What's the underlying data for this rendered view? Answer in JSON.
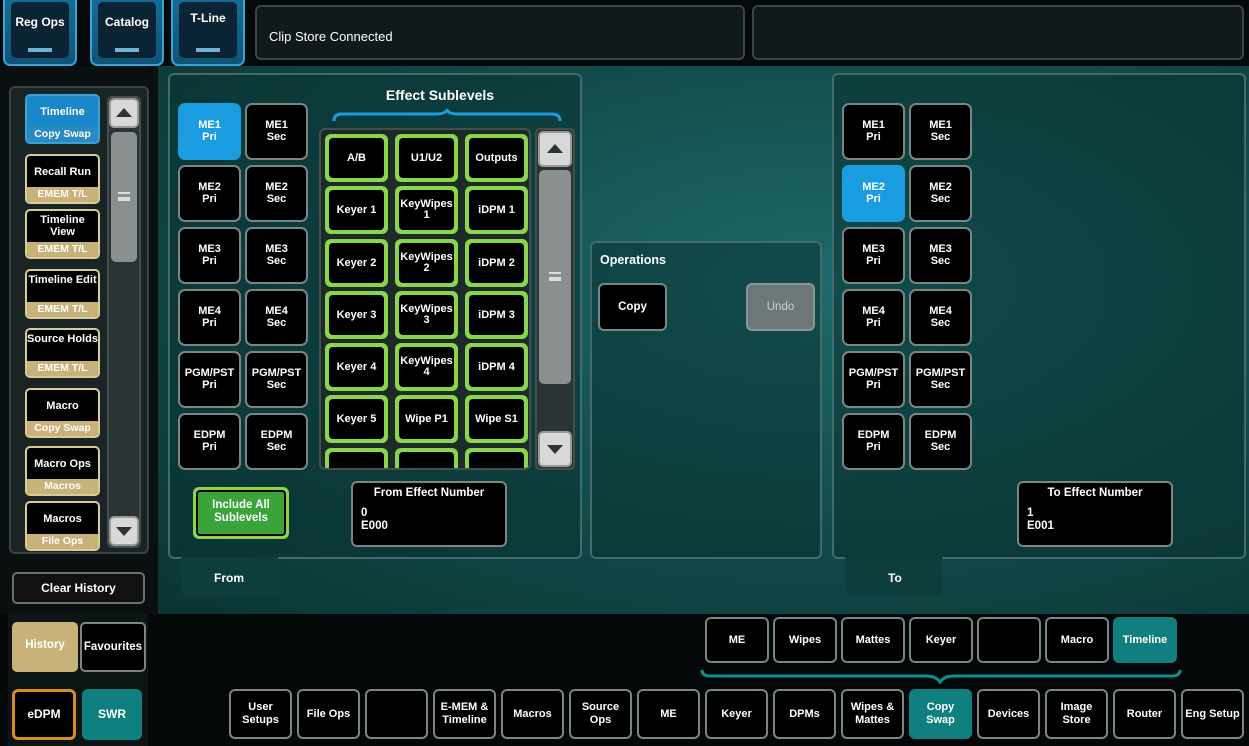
{
  "top_tabs": [
    "Reg Ops",
    "Catalog",
    "T-Line"
  ],
  "status": "Clip Store Connected",
  "history": {
    "items": [
      {
        "title": "Timeline",
        "sub": "Copy Swap",
        "active": true
      },
      {
        "title": "Recall Run",
        "sub": "EMEM T/L"
      },
      {
        "title": "Timeline View",
        "sub": "EMEM T/L"
      },
      {
        "title": "Timeline Edit",
        "sub": "EMEM T/L"
      },
      {
        "title": "Source Holds",
        "sub": "EMEM T/L"
      },
      {
        "title": "Macro",
        "sub": "Copy Swap"
      },
      {
        "title": "Macro Ops",
        "sub": "Macros"
      },
      {
        "title": "Macros",
        "sub": "File Ops"
      }
    ],
    "clear_label": "Clear History",
    "history_tab": "History",
    "favourites_tab": "Favourites"
  },
  "from_panel": {
    "title": "Effect Sublevels",
    "me_buttons": [
      [
        "ME1 Pri",
        "ME1 Sec"
      ],
      [
        "ME2 Pri",
        "ME2 Sec"
      ],
      [
        "ME3 Pri",
        "ME3 Sec"
      ],
      [
        "ME4 Pri",
        "ME4 Sec"
      ],
      [
        "PGM/PST Pri",
        "PGM/PST Sec"
      ],
      [
        "EDPM Pri",
        "EDPM Sec"
      ]
    ],
    "selected": "ME1 Pri",
    "sublevels": [
      [
        "A/B",
        "U1/U2",
        "Outputs"
      ],
      [
        "Keyer 1",
        "KeyWipes 1",
        "iDPM 1"
      ],
      [
        "Keyer 2",
        "KeyWipes 2",
        "iDPM 2"
      ],
      [
        "Keyer 3",
        "KeyWipes 3",
        "iDPM 3"
      ],
      [
        "Keyer 4",
        "KeyWipes 4",
        "iDPM 4"
      ],
      [
        "Keyer 5",
        "Wipe P1",
        "Wipe S1"
      ]
    ],
    "include_all": "Include All Sublevels",
    "effect_number_title": "From Effect Number",
    "effect_number": "0",
    "effect_name": "E000",
    "tab": "From"
  },
  "operations": {
    "title": "Operations",
    "copy": "Copy",
    "undo": "Undo"
  },
  "to_panel": {
    "me_buttons": [
      [
        "ME1 Pri",
        "ME1 Sec"
      ],
      [
        "ME2 Pri",
        "ME2 Sec"
      ],
      [
        "ME3 Pri",
        "ME3 Sec"
      ],
      [
        "ME4 Pri",
        "ME4 Sec"
      ],
      [
        "PGM/PST Pri",
        "PGM/PST Sec"
      ],
      [
        "EDPM Pri",
        "EDPM Sec"
      ]
    ],
    "selected": "ME2 Pri",
    "effect_number_title": "To Effect Number",
    "effect_number": "1",
    "effect_name": "E001",
    "tab": "To"
  },
  "sub_nav": [
    "ME",
    "Wipes",
    "Mattes",
    "Keyer",
    "",
    "Macro",
    "Timeline"
  ],
  "sub_nav_active": "Timeline",
  "mode_buttons": [
    "eDPM",
    "SWR"
  ],
  "main_nav": [
    "User Setups",
    "File Ops",
    "",
    "E-MEM & Timeline",
    "Macros",
    "Source Ops",
    "ME",
    "Keyer",
    "DPMs",
    "Wipes & Mattes",
    "Copy Swap",
    "Devices",
    "Image Store",
    "Router",
    "Eng Setup"
  ],
  "main_nav_active": "Copy Swap",
  "colors": {
    "accent_blue": "#1a9de0",
    "accent_green": "#8ad64a",
    "accent_teal": "#0f7f7f",
    "history_gold": "#c9b27a",
    "edpm_orange": "#d98a2a"
  }
}
